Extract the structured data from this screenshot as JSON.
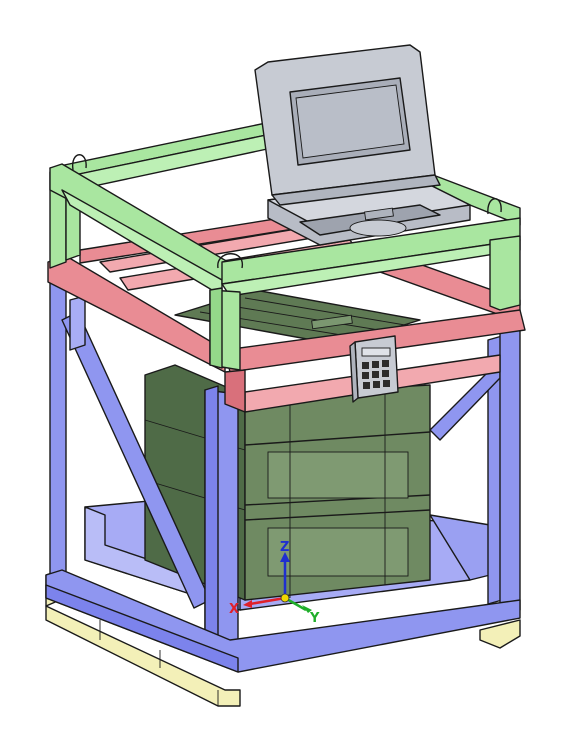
{
  "axes": {
    "x_label": "X",
    "y_label": "Y",
    "z_label": "Z",
    "x_color": "#e0202a",
    "y_color": "#1fae2a",
    "z_color": "#1f2fd0"
  },
  "colors": {
    "top_frame": "#a9e6a0",
    "red_frame": "#e98c94",
    "blue_frame": "#8f96f0",
    "base_tray": "#a7abf5",
    "pallet": "#f3f0b8",
    "crate": "#6f8a62",
    "laptop": "#c7cbd3"
  },
  "components": {
    "top_frame": "lifting-frame",
    "red_frame": "support-frame",
    "blue_frame": "cage-frame",
    "crate": "storage-crate",
    "laptop": "laptop",
    "keypad": "keypad-box",
    "pallet": "pallet-base"
  }
}
